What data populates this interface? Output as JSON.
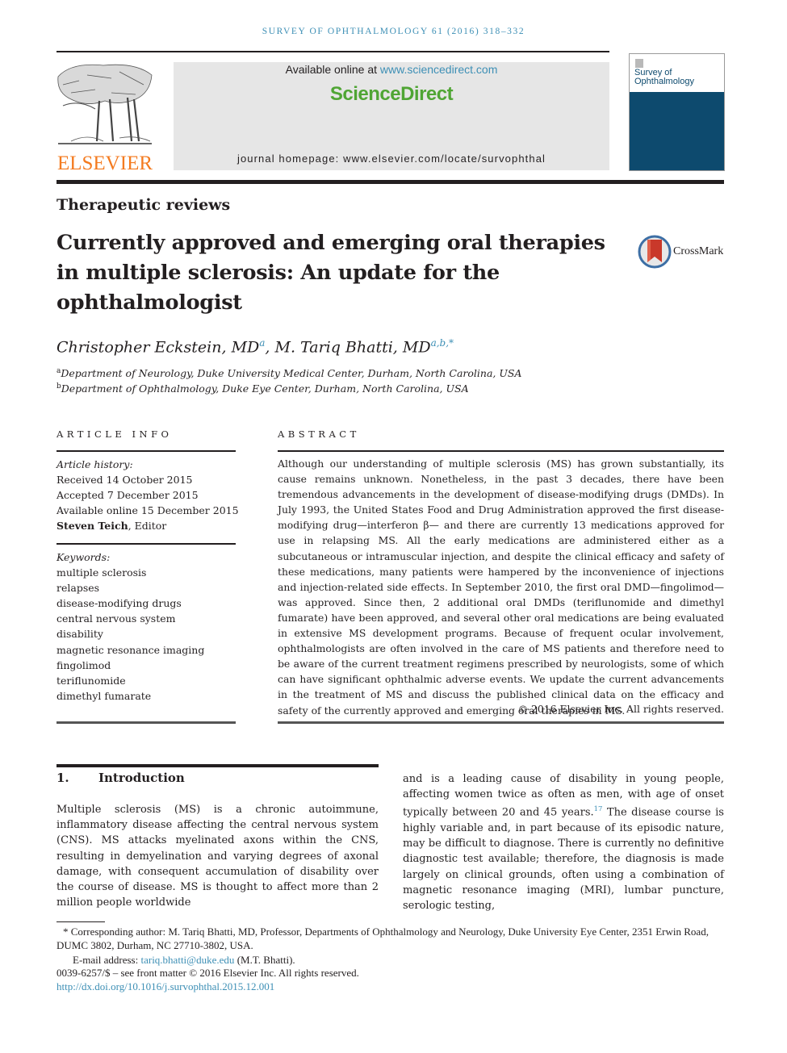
{
  "running_head": "SURVEY OF OPHTHALMOLOGY 61 (2016) 318–332",
  "masthead": {
    "publisher": "ELSEVIER",
    "available_prefix": "Available online at ",
    "available_link": "www.sciencedirect.com",
    "platform": "ScienceDirect",
    "homepage": "journal homepage: www.elsevier.com/locate/survophthal",
    "cover_title_line1": "Survey of",
    "cover_title_line2": "Ophthalmology",
    "colors": {
      "link": "#3d8fb5",
      "platform": "#4fa534",
      "publisher": "#f47b20",
      "cover": "#0d4a6e"
    }
  },
  "article": {
    "section": "Therapeutic reviews",
    "title": "Currently approved and emerging oral therapies in multiple sclerosis: An update for the ophthalmologist",
    "crossmark_label": "CrossMark",
    "authors": [
      {
        "name": "Christopher Eckstein, MD",
        "marks": "a"
      },
      {
        "name": "M. Tariq Bhatti, MD",
        "marks": "a,b,*"
      }
    ],
    "affiliations": [
      {
        "mark": "a",
        "text": "Department of Neurology, Duke University Medical Center, Durham, North Carolina, USA"
      },
      {
        "mark": "b",
        "text": "Department of Ophthalmology, Duke Eye Center, Durham, North Carolina, USA"
      }
    ]
  },
  "article_info": {
    "heading": "ARTICLE INFO",
    "history_label": "Article history:",
    "received": "Received 14 October 2015",
    "accepted": "Accepted 7 December 2015",
    "online": "Available online 15 December 2015",
    "editor_name": "Steven Teich",
    "editor_suffix": ", Editor",
    "keywords_label": "Keywords:",
    "keywords": [
      "multiple sclerosis",
      "relapses",
      "disease-modifying drugs",
      "central nervous system",
      "disability",
      "magnetic resonance imaging",
      "fingolimod",
      "teriflunomide",
      "dimethyl fumarate"
    ]
  },
  "abstract": {
    "heading": "ABSTRACT",
    "text": "Although our understanding of multiple sclerosis (MS) has grown substantially, its cause remains unknown. Nonetheless, in the past 3 decades, there have been tremendous advancements in the development of disease-modifying drugs (DMDs). In July 1993, the United States Food and Drug Administration approved the first disease-modifying drug—interferon β— and there are currently 13 medications approved for use in relapsing MS. All the early medications are administered either as a subcutaneous or intramuscular injection, and despite the clinical efficacy and safety of these medications, many patients were hampered by the inconvenience of injections and injection-related side effects. In September 2010, the first oral DMD—fingolimod—was approved. Since then, 2 additional oral DMDs (teriflunomide and dimethyl fumarate) have been approved, and several other oral medications are being evaluated in extensive MS development programs. Because of frequent ocular involvement, ophthalmologists are often involved in the care of MS patients and therefore need to be aware of the current treatment regimens prescribed by neurologists, some of which can have significant ophthalmic adverse events. We update the current advancements in the treatment of MS and discuss the published clinical data on the efficacy and safety of the currently approved and emerging oral therapies in MS.",
    "copyright": "© 2016 Elsevier Inc. All rights reserved."
  },
  "introduction": {
    "number": "1.",
    "heading": "Introduction",
    "col1": "Multiple sclerosis (MS) is a chronic autoimmune, inflammatory disease affecting the central nervous system (CNS). MS attacks myelinated axons within the CNS, resulting in demyelination and varying degrees of axonal damage, with consequent accumulation of disability over the course of disease. MS is thought to affect more than 2 million people worldwide",
    "col2_before_ref": "and is a leading cause of disability in young people, affecting women twice as often as men, with age of onset typically between 20 and 45 years.",
    "col2_ref": "17",
    "col2_after_ref": " The disease course is highly variable and, in part because of its episodic nature, may be difficult to diagnose. There is currently no definitive diagnostic test available; therefore, the diagnosis is made largely on clinical grounds, often using a combination of magnetic resonance imaging (MRI), lumbar puncture, serologic testing,"
  },
  "footnotes": {
    "corresponding": "* Corresponding author: M. Tariq Bhatti, MD, Professor, Departments of Ophthalmology and Neurology, Duke University Eye Center, 2351 Erwin Road, DUMC 3802, Durham, NC 27710-3802, USA.",
    "email_label": "E-mail address: ",
    "email": "tariq.bhatti@duke.edu",
    "email_suffix": " (M.T. Bhatti).",
    "issn": "0039-6257/$ – see front matter © 2016 Elsevier Inc. All rights reserved.",
    "doi": "http://dx.doi.org/10.1016/j.survophthal.2015.12.001"
  }
}
